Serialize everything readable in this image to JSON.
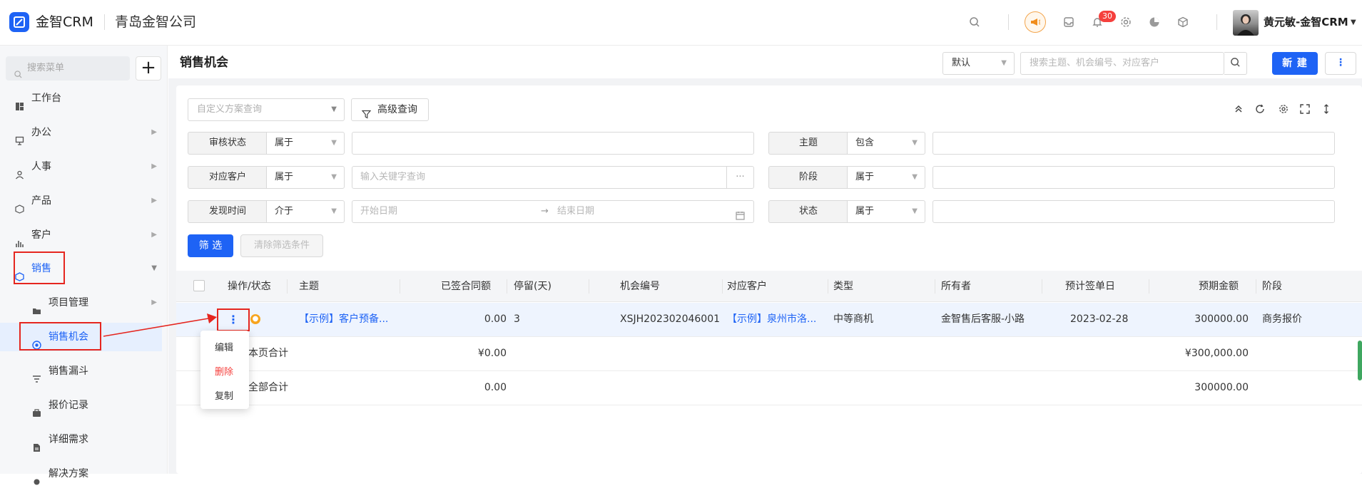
{
  "header": {
    "app_name": "金智CRM",
    "company": "青岛金智公司",
    "notification_count": "30",
    "user_name": "黄元敏-金智CRM",
    "icons": [
      "search-icon",
      "promo-icon",
      "inbox-icon",
      "bell-icon",
      "gear-icon",
      "chart-icon",
      "box-icon"
    ]
  },
  "sidebar": {
    "search_placeholder": "搜索菜单",
    "add_label": "+",
    "items": [
      {
        "label": "工作台"
      },
      {
        "label": "办公"
      },
      {
        "label": "人事"
      },
      {
        "label": "产品"
      },
      {
        "label": "客户"
      },
      {
        "label": "销售"
      },
      {
        "label": "项目管理"
      },
      {
        "label": "销售机会"
      },
      {
        "label": "销售漏斗"
      },
      {
        "label": "报价记录"
      },
      {
        "label": "详细需求"
      },
      {
        "label": "解决方案"
      }
    ]
  },
  "page": {
    "title": "销售机会",
    "view_select": "默认",
    "search_placeholder": "搜索主题、机会编号、对应客户",
    "new_button": "新 建"
  },
  "filter": {
    "scheme_placeholder": "自定义方案查询",
    "advanced_label": "高级查询",
    "rows": [
      {
        "label": "审核状态",
        "op": "属于",
        "value": ""
      },
      {
        "label": "主题",
        "op": "包含",
        "value": ""
      },
      {
        "label": "对应客户",
        "op": "属于",
        "placeholder": "输入关键字查询",
        "more": "···"
      },
      {
        "label": "阶段",
        "op": "属于",
        "value": ""
      },
      {
        "label": "发现时间",
        "op": "介于",
        "start_placeholder": "开始日期",
        "arrow": "→",
        "end_placeholder": "结束日期"
      },
      {
        "label": "状态",
        "op": "属于",
        "value": ""
      }
    ],
    "filter_button": "筛 选",
    "clear_button": "清除筛选条件"
  },
  "table": {
    "columns": [
      "操作/状态",
      "主题",
      "已签合同额",
      "停留(天)",
      "机会编号",
      "对应客户",
      "类型",
      "所有者",
      "预计签单日",
      "预期金额",
      "阶段"
    ],
    "rows": [
      {
        "action": "⋮",
        "subject": "【示例】客户预备...",
        "signed": "0.00",
        "stay": "3",
        "code": "XSJH202302046001",
        "customer": "【示例】泉州市洛...",
        "type": "中等商机",
        "owner": "金智售后客服-小路",
        "date": "2023-02-28",
        "amount": "300000.00",
        "stage": "商务报价"
      }
    ],
    "page_total": {
      "label": "本页合计",
      "signed": "¥0.00",
      "amount": "¥300,000.00"
    },
    "all_total": {
      "label": "全部合计",
      "signed": "0.00",
      "amount": "300000.00"
    }
  },
  "row_menu": {
    "items": [
      "编辑",
      "删除",
      "复制"
    ]
  },
  "colors": {
    "accent": "#1e63f5",
    "danger": "#f5403d",
    "highlight": "#e5261f"
  }
}
